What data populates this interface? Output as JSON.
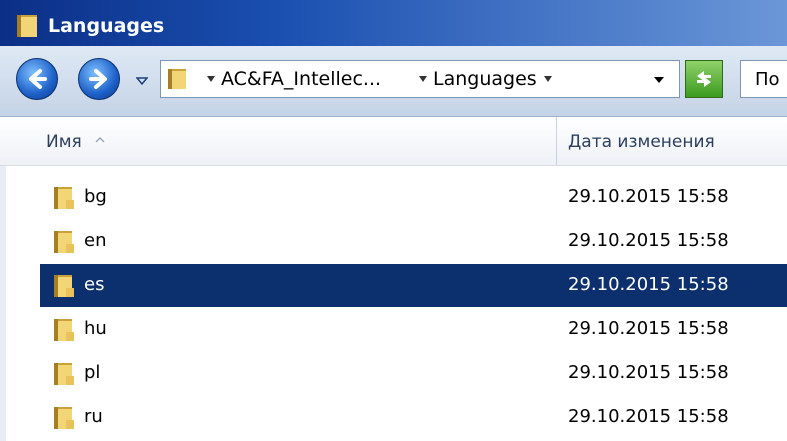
{
  "window": {
    "title": "Languages"
  },
  "addressbar": {
    "breadcrumbs": [
      "AC&FA_Intellec...",
      "Languages"
    ],
    "search_text": "По"
  },
  "columns": {
    "name": "Имя",
    "date_modified": "Дата изменения"
  },
  "files": [
    {
      "name": "bg",
      "date": "29.10.2015 15:58",
      "selected": false
    },
    {
      "name": "en",
      "date": "29.10.2015 15:58",
      "selected": false
    },
    {
      "name": "es",
      "date": "29.10.2015 15:58",
      "selected": true
    },
    {
      "name": "hu",
      "date": "29.10.2015 15:58",
      "selected": false
    },
    {
      "name": "pl",
      "date": "29.10.2015 15:58",
      "selected": false
    },
    {
      "name": "ru",
      "date": "29.10.2015 15:58",
      "selected": false
    }
  ],
  "colors": {
    "selection": "#0c2f6e",
    "title_bar": "#1a4fb0",
    "folder": "#e8c25a"
  },
  "icons": {
    "folder": "folder-icon",
    "back": "back-arrow-icon",
    "forward": "forward-arrow-icon",
    "refresh": "refresh-icon"
  }
}
